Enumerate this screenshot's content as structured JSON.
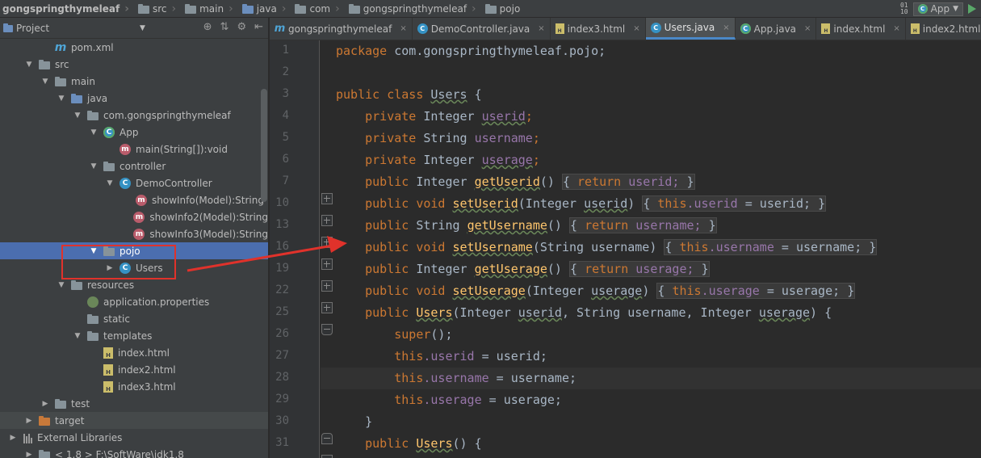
{
  "breadcrumb": [
    "gongspringthymeleaf",
    "src",
    "main",
    "java",
    "com",
    "gongspringthymeleaf",
    "pojo"
  ],
  "toolbar": {
    "run_config": "App",
    "sort_icon": "sort-icon"
  },
  "project_panel": {
    "title": "Project",
    "tree": [
      {
        "label": "pom.xml",
        "icon": "maven-icon",
        "depth": 1,
        "arrow": ""
      },
      {
        "label": "src",
        "icon": "folder-icon",
        "depth": 0,
        "arrow": "▼"
      },
      {
        "label": "main",
        "icon": "folder-icon",
        "depth": 1,
        "arrow": "▼"
      },
      {
        "label": "java",
        "icon": "source-folder-icon",
        "depth": 2,
        "arrow": "▼"
      },
      {
        "label": "com.gongspringthymeleaf",
        "icon": "package-icon",
        "depth": 3,
        "arrow": "▼"
      },
      {
        "label": "App",
        "icon": "app-class-icon",
        "depth": 4,
        "arrow": "▼"
      },
      {
        "label": "main(String[]):void",
        "icon": "method-icon",
        "depth": 5,
        "arrow": ""
      },
      {
        "label": "controller",
        "icon": "package-icon",
        "depth": 4,
        "arrow": "▼"
      },
      {
        "label": "DemoController",
        "icon": "class-icon",
        "depth": 5,
        "arrow": "▼"
      },
      {
        "label": "showInfo(Model):String",
        "icon": "method-icon",
        "depth": 6,
        "arrow": ""
      },
      {
        "label": "showInfo2(Model):String",
        "icon": "method-icon",
        "depth": 6,
        "arrow": ""
      },
      {
        "label": "showInfo3(Model):String",
        "icon": "method-icon",
        "depth": 6,
        "arrow": ""
      },
      {
        "label": "pojo",
        "icon": "package-icon",
        "depth": 4,
        "arrow": "▼",
        "selected": true
      },
      {
        "label": "Users",
        "icon": "class-icon",
        "depth": 5,
        "arrow": "▶"
      },
      {
        "label": "resources",
        "icon": "resources-folder-icon",
        "depth": 2,
        "arrow": "▼"
      },
      {
        "label": "application.properties",
        "icon": "properties-icon",
        "depth": 3,
        "arrow": ""
      },
      {
        "label": "static",
        "icon": "folder-icon",
        "depth": 3,
        "arrow": ""
      },
      {
        "label": "templates",
        "icon": "folder-icon",
        "depth": 3,
        "arrow": "▼"
      },
      {
        "label": "index.html",
        "icon": "html-icon",
        "depth": 4,
        "arrow": ""
      },
      {
        "label": "index2.html",
        "icon": "html-icon",
        "depth": 4,
        "arrow": ""
      },
      {
        "label": "index3.html",
        "icon": "html-icon",
        "depth": 4,
        "arrow": ""
      },
      {
        "label": "test",
        "icon": "folder-icon",
        "depth": 1,
        "arrow": "▶"
      },
      {
        "label": "target",
        "icon": "excluded-folder-icon",
        "depth": 0,
        "arrow": "▶",
        "dark": true
      },
      {
        "label": "External Libraries",
        "icon": "libraries-icon",
        "depth": -1,
        "arrow": "▶"
      },
      {
        "label": "< 1.8 >  F:\\SoftWare\\jdk1.8",
        "icon": "jdk-icon",
        "depth": 0,
        "arrow": "▶"
      }
    ]
  },
  "editor": {
    "tabs": [
      {
        "label": "gongspringthymeleaf",
        "icon": "maven-icon",
        "active": false
      },
      {
        "label": "DemoController.java",
        "icon": "class-icon",
        "active": false
      },
      {
        "label": "index3.html",
        "icon": "html-icon",
        "active": false
      },
      {
        "label": "Users.java",
        "icon": "class-icon",
        "active": true
      },
      {
        "label": "App.java",
        "icon": "app-class-icon",
        "active": false
      },
      {
        "label": "index.html",
        "icon": "html-icon",
        "active": false
      },
      {
        "label": "index2.html",
        "icon": "html-icon",
        "active": false
      }
    ],
    "close_glyph": "×",
    "line_numbers": [
      "1",
      "2",
      "3",
      "4",
      "5",
      "6",
      "7",
      "10",
      "13",
      "16",
      "19",
      "22",
      "25",
      "26",
      "27",
      "28",
      "29",
      "30",
      "31"
    ],
    "code": {
      "l1_kw": "package",
      "l1_rest": " com.gongspringthymeleaf.pojo;",
      "l3_kw": "public class",
      "l3_cls": "Users",
      "l3_rest": " {",
      "l4_kw": "private",
      "l4_type": " Integer ",
      "l4_fld": "userid",
      "l4_end": ";",
      "l5_kw": "private",
      "l5_type": " String ",
      "l5_fld": "username",
      "l5_end": ";",
      "l6_kw": "private",
      "l6_type": " Integer ",
      "l6_fld": "userage",
      "l6_end": ";",
      "l7_kw": "public",
      "l7_type": " Integer ",
      "l7_fn": "getUserid",
      "l7_args": "() ",
      "l7_body_kw": "return",
      "l7_body": " userid; ",
      "l7_close": "}",
      "l7_open": "{ ",
      "l10_kw": "public void",
      "l10_fn": "setUserid",
      "l10_args": "(Integer ",
      "l10_param": "userid",
      "l10_args2": ") ",
      "l10_open": "{ ",
      "l10_this": "this",
      "l10_fld": ".userid",
      "l10_body": " = userid; ",
      "l10_close": "}",
      "l13_kw": "public",
      "l13_type": " String ",
      "l13_fn": "getUsername",
      "l13_args": "() ",
      "l13_open": "{ ",
      "l13_body_kw": "return",
      "l13_body": " username; ",
      "l13_close": "}",
      "l16_kw": "public void",
      "l16_fn": "setUsername",
      "l16_args": "(String username) ",
      "l16_open": "{ ",
      "l16_this": "this",
      "l16_fld": ".username",
      "l16_body": " = username; ",
      "l16_close": "}",
      "l19_kw": "public",
      "l19_type": " Integer ",
      "l19_fn": "getUserage",
      "l19_args": "() ",
      "l19_open": "{ ",
      "l19_body_kw": "return",
      "l19_body": " userage; ",
      "l19_close": "}",
      "l22_kw": "public void",
      "l22_fn": "setUserage",
      "l22_args": "(Integer ",
      "l22_param": "userage",
      "l22_args2": ") ",
      "l22_open": "{ ",
      "l22_this": "this",
      "l22_fld": ".userage",
      "l22_body": " = userage; ",
      "l22_close": "}",
      "l25_kw": "public",
      "l25_fn": "Users",
      "l25_args": "(Integer ",
      "l25_p1": "userid",
      "l25_mid": ", String username, Integer ",
      "l25_p3": "userage",
      "l25_end": ") {",
      "l26_kw": "super",
      "l26_rest": "();",
      "l27_kw": "this",
      "l27_fld": ".userid",
      "l27_rest": " = userid;",
      "l28_kw": "this",
      "l28_fld": ".username",
      "l28_rest": " = username;",
      "l29_kw": "this",
      "l29_fld": ".userage",
      "l29_rest": " = userage;",
      "l30": "}",
      "l31_kw": "public",
      "l31_fn": "Users",
      "l31_rest": "() {"
    }
  },
  "annotation": {
    "box_color": "#e0322b",
    "arrow_color": "#e0322b"
  },
  "colors": {
    "keyword": "#cc7832",
    "field": "#9876aa",
    "method": "#ffc66d",
    "text": "#a9b7c6",
    "selection": "#4b6eaf"
  }
}
